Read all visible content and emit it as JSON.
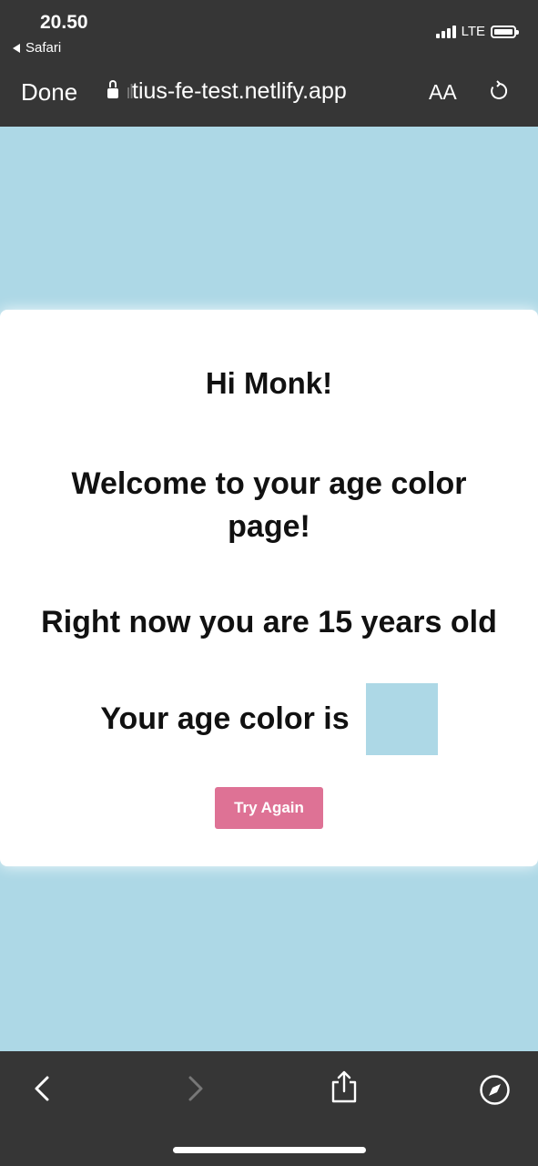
{
  "status_bar": {
    "time": "20.50",
    "back_app": "Safari",
    "network": "LTE"
  },
  "browser": {
    "done_label": "Done",
    "url_fade": "ıl",
    "url": "tius-fe-test.netlify.app",
    "text_size_label": "AA"
  },
  "page": {
    "greeting": "Hi Monk!",
    "welcome": "Welcome to your age color page!",
    "age_text": "Right now you are 15 years old",
    "color_label": "Your age color is",
    "age_color": "#add8e6",
    "try_again_label": "Try Again"
  },
  "toolbar": {
    "icons": [
      "back-icon",
      "forward-icon",
      "share-icon",
      "compass-icon"
    ]
  }
}
